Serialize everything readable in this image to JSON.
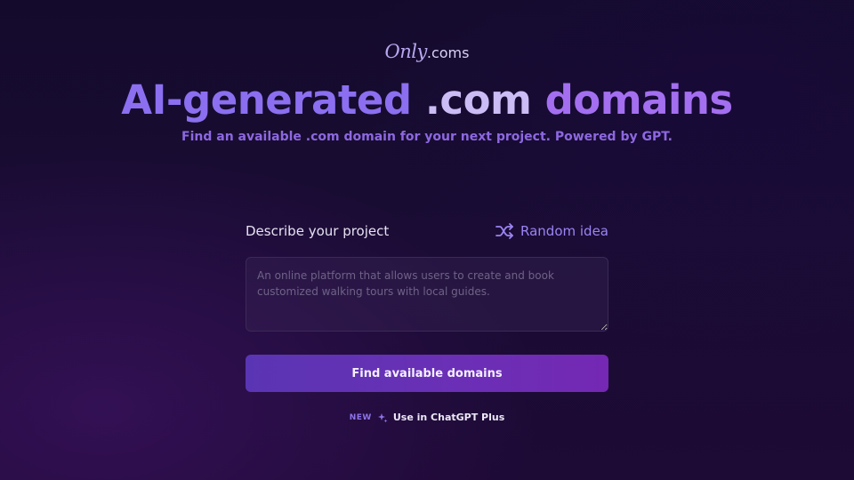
{
  "logo": {
    "script": "Only",
    "suffix": ".coms"
  },
  "headline": {
    "part1": "AI-generated",
    "part2": ".com",
    "part3": "domains"
  },
  "subtitle": "Find an available .com domain for your next project. Powered by GPT.",
  "form": {
    "label": "Describe your project",
    "random_idea": "Random idea",
    "placeholder": "An online platform that allows users to create and book customized walking tours with local guides.",
    "value": "",
    "submit_label": "Find available domains"
  },
  "chatgpt": {
    "badge": "NEW",
    "label": "Use in ChatGPT Plus"
  },
  "colors": {
    "accent": "#8b6ff0",
    "button_start": "#5a35b3",
    "button_end": "#7428b3"
  },
  "icons": {
    "random": "shuffle-icon",
    "chatgpt": "sparkle-icon"
  }
}
